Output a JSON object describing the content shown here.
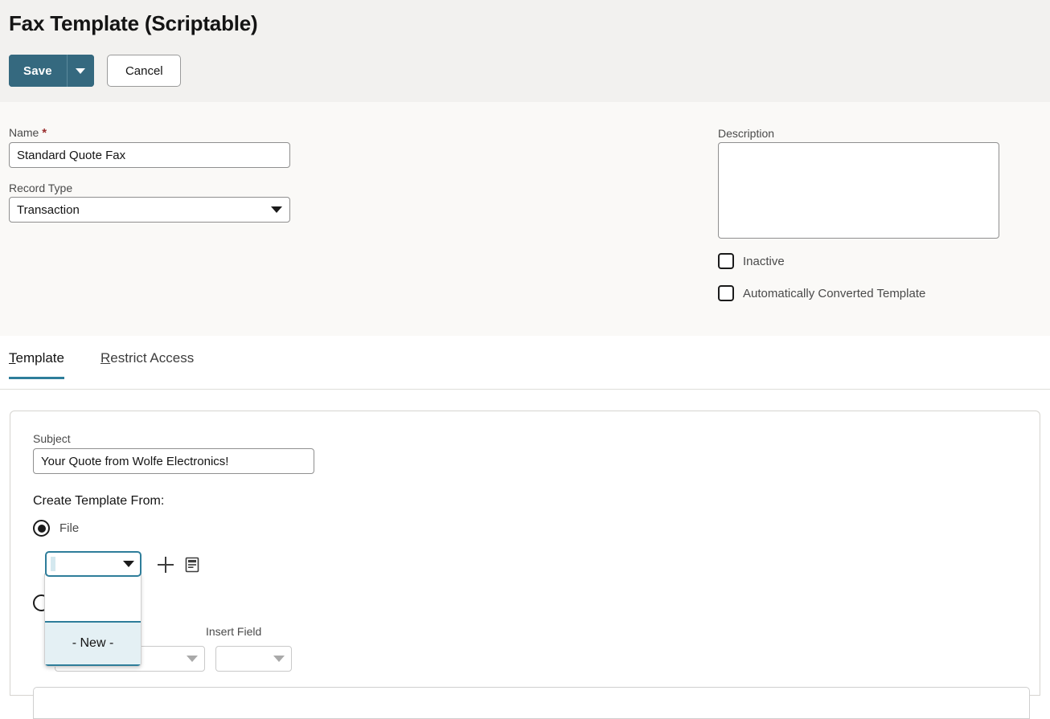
{
  "header": {
    "title": "Fax Template (Scriptable)",
    "save_label": "Save",
    "save_caret_icon": "chevron-down-icon",
    "cancel_label": "Cancel"
  },
  "form": {
    "name_label": "Name",
    "name_required_marker": "*",
    "name_value": "Standard Quote Fax",
    "record_type_label": "Record Type",
    "record_type_value": "Transaction",
    "record_type_caret_icon": "chevron-down-icon",
    "description_label": "Description",
    "description_value": "",
    "description_placeholder": "",
    "inactive_label": "Inactive",
    "inactive_checked": false,
    "auto_converted_label": "Automatically Converted Template",
    "auto_converted_checked": false
  },
  "tabs": {
    "items": [
      {
        "accesskey": "T",
        "rest": "emplate",
        "label": "Template",
        "active": true
      },
      {
        "accesskey": "R",
        "rest": "estrict Access",
        "label": "Restrict Access",
        "active": false
      }
    ]
  },
  "template_panel": {
    "subject_label": "Subject",
    "subject_value": "Your Quote from Wolfe Electronics!",
    "create_from_label": "Create Template From:",
    "radio_file_label": "File",
    "radio_file_selected": true,
    "file_select_value": "",
    "add_icon": "plus-icon",
    "list_icon": "document-list-icon",
    "file_dropdown": {
      "open": true,
      "options": [
        {
          "label": "",
          "highlighted": false
        },
        {
          "label": "- New -",
          "highlighted": true
        }
      ]
    },
    "hidden_select_value": "",
    "hidden_select_caret_icon": "chevron-down-icon",
    "insert_field_label": "Insert Field",
    "insert_field_value": "",
    "insert_field_caret_icon": "chevron-down-icon"
  },
  "colors": {
    "accent": "#2e7d9a",
    "primary_button": "#35697f",
    "header_band": "#f2f1ef",
    "form_band": "#faf9f7",
    "required_star": "#9a2f2f",
    "dropdown_highlight": "#e4f0f4"
  }
}
